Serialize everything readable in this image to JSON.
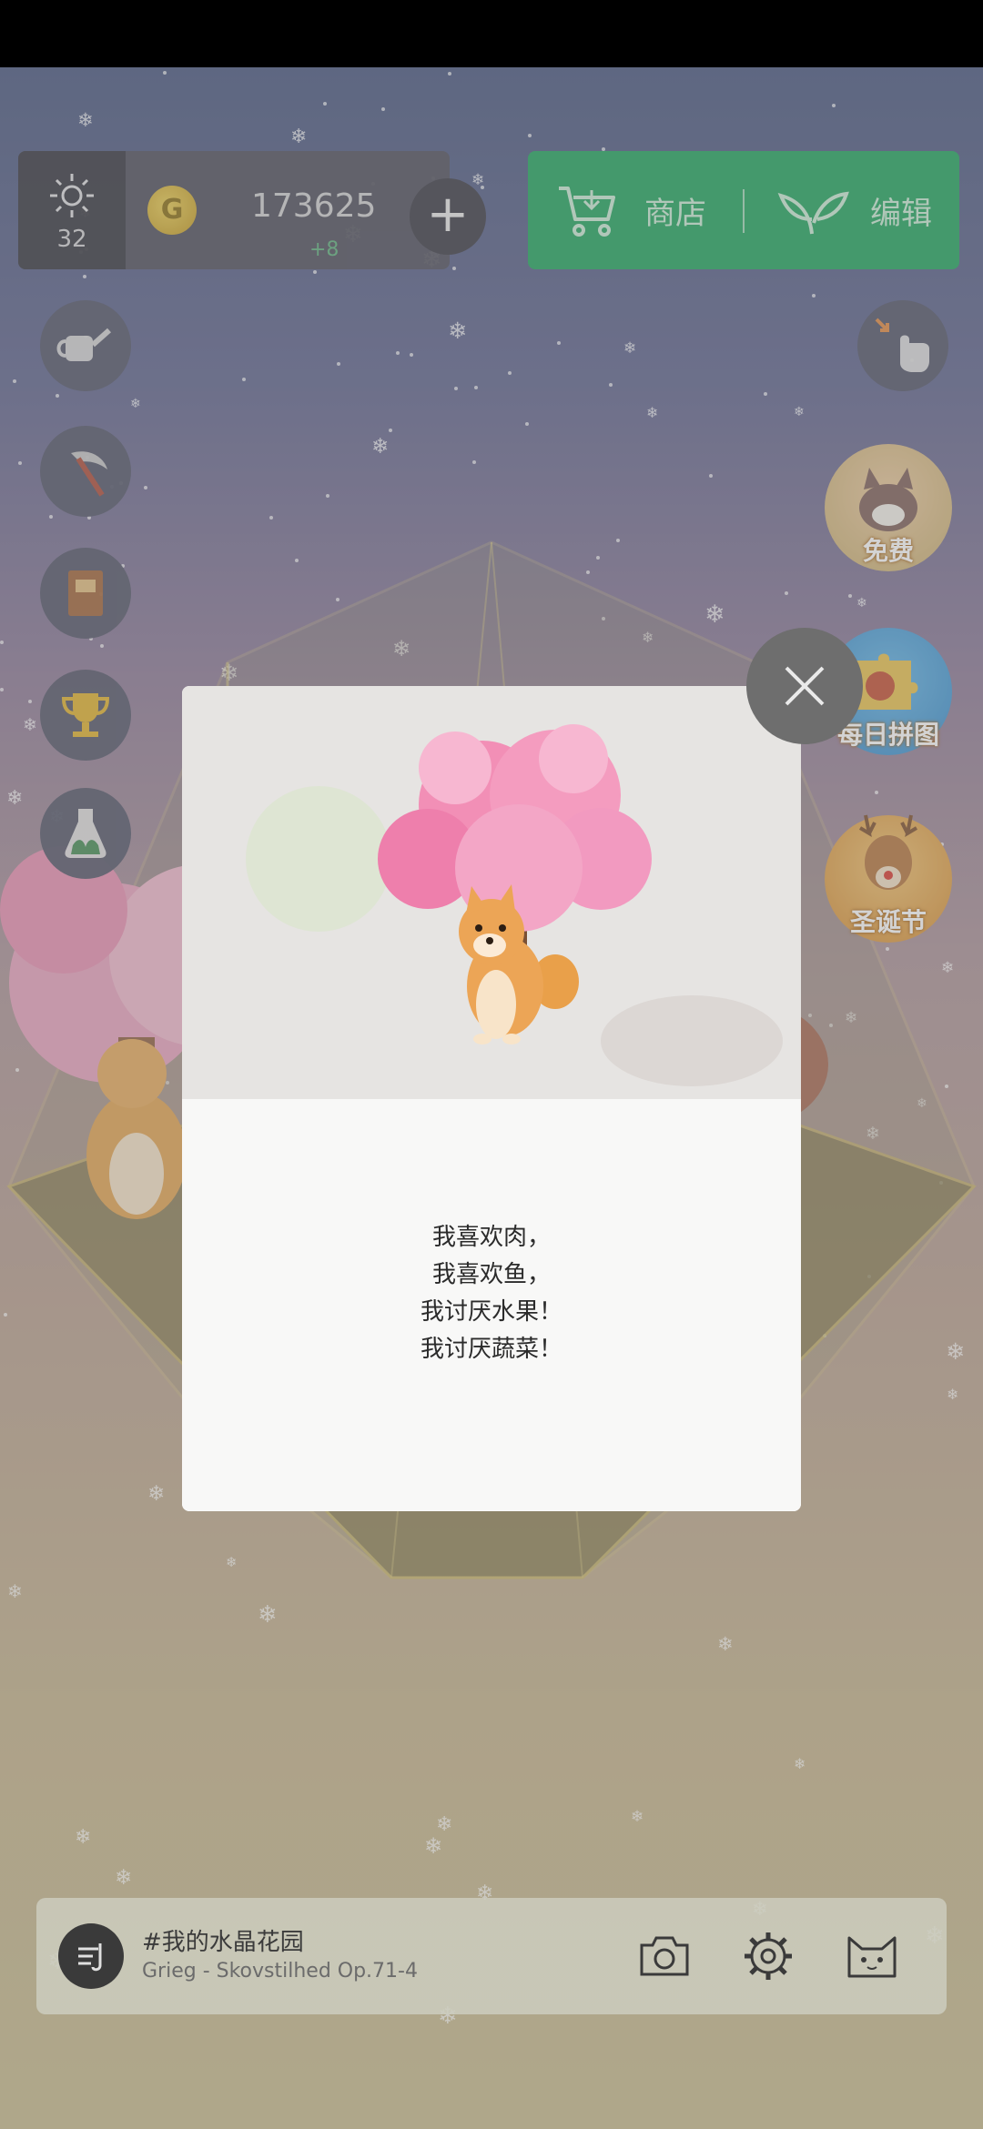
{
  "resources": {
    "sunlight_count": "32",
    "gold_amount": "173625",
    "gold_increment": "+8"
  },
  "shop_bar": {
    "shop_label": "商店",
    "edit_label": "编辑"
  },
  "right_buttons": {
    "free_label": "免费",
    "puzzle_label": "每日拼图",
    "christmas_label": "圣诞节"
  },
  "dialog": {
    "lines": [
      "我喜欢肉，",
      "我喜欢鱼，",
      "我讨厌水果！",
      "我讨厌蔬菜！"
    ]
  },
  "music_bar": {
    "title": "#我的水晶花园",
    "track": "Grieg - Skovstilhed Op.71-4"
  },
  "icons": [
    "sun-icon",
    "coin-icon",
    "plus-icon",
    "cart-icon",
    "sprout-icon",
    "watering-can-icon",
    "scythe-icon",
    "book-icon",
    "trophy-icon",
    "potion-icon",
    "collapse-hand-icon",
    "cat-icon",
    "puzzle-icon",
    "deer-icon",
    "close-icon",
    "music-disc-icon",
    "camera-icon",
    "gear-icon",
    "cat-face-icon"
  ]
}
